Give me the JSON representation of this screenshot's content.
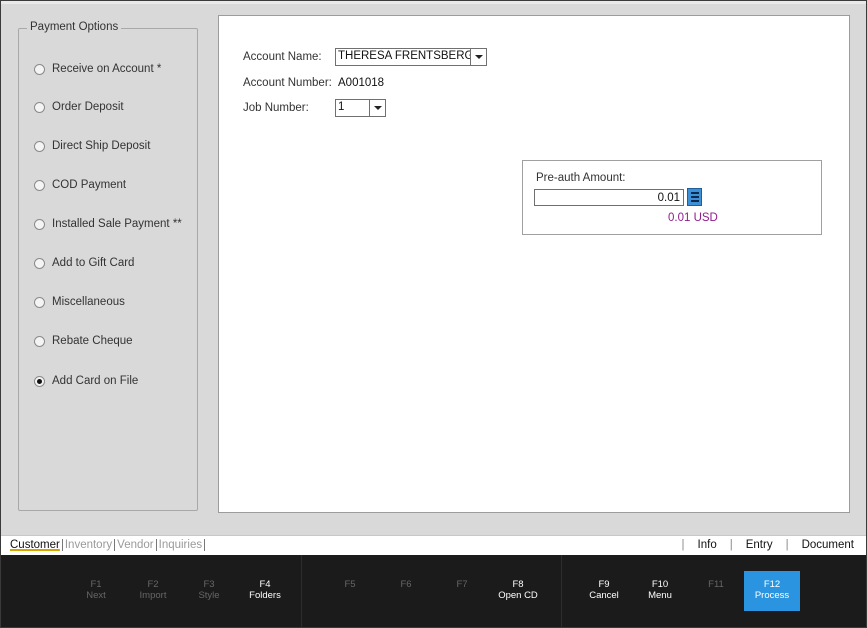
{
  "payment_options": {
    "legend": "Payment Options",
    "items": [
      {
        "label": "Receive on Account *",
        "checked": false
      },
      {
        "label": "Order Deposit",
        "checked": false
      },
      {
        "label": "Direct Ship Deposit",
        "checked": false
      },
      {
        "label": "COD Payment",
        "checked": false
      },
      {
        "label": "Installed Sale Payment **",
        "checked": false
      },
      {
        "label": "Add to Gift Card",
        "checked": false
      },
      {
        "label": "Miscellaneous",
        "checked": false
      },
      {
        "label": "Rebate Cheque",
        "checked": false
      },
      {
        "label": "Add Card on File",
        "checked": true
      }
    ]
  },
  "form": {
    "account_name_label": "Account Name:",
    "account_name_value": "THERESA FRENTSBERG",
    "account_number_label": "Account Number:",
    "account_number_value": "A001018",
    "job_number_label": "Job Number:",
    "job_number_value": "1"
  },
  "preauth": {
    "label": "Pre-auth Amount:",
    "value": "0.01",
    "converted": "0.01 USD",
    "converted_color": "#8e1c8e"
  },
  "bottom_tabs": {
    "left": [
      "Customer",
      "Inventory",
      "Vendor",
      "Inquiries"
    ],
    "active": "Customer",
    "right": [
      "Info",
      "Entry",
      "Document"
    ]
  },
  "function_keys": [
    {
      "key": "F1",
      "label": "Next",
      "enabled": false
    },
    {
      "key": "F2",
      "label": "Import",
      "enabled": false
    },
    {
      "key": "F3",
      "label": "Style",
      "enabled": false
    },
    {
      "key": "F4",
      "label": "Folders",
      "enabled": true
    },
    {
      "key": "F5",
      "label": "",
      "enabled": false
    },
    {
      "key": "F6",
      "label": "",
      "enabled": false
    },
    {
      "key": "F7",
      "label": "",
      "enabled": false
    },
    {
      "key": "F8",
      "label": "Open CD",
      "enabled": true
    },
    {
      "key": "F9",
      "label": "Cancel",
      "enabled": true
    },
    {
      "key": "F10",
      "label": "Menu",
      "enabled": true
    },
    {
      "key": "F11",
      "label": "",
      "enabled": false
    },
    {
      "key": "F12",
      "label": "Process",
      "enabled": true,
      "primary": true
    }
  ],
  "colors": {
    "accent": "#2b94e0",
    "calc_button": "#3d8fd6"
  }
}
